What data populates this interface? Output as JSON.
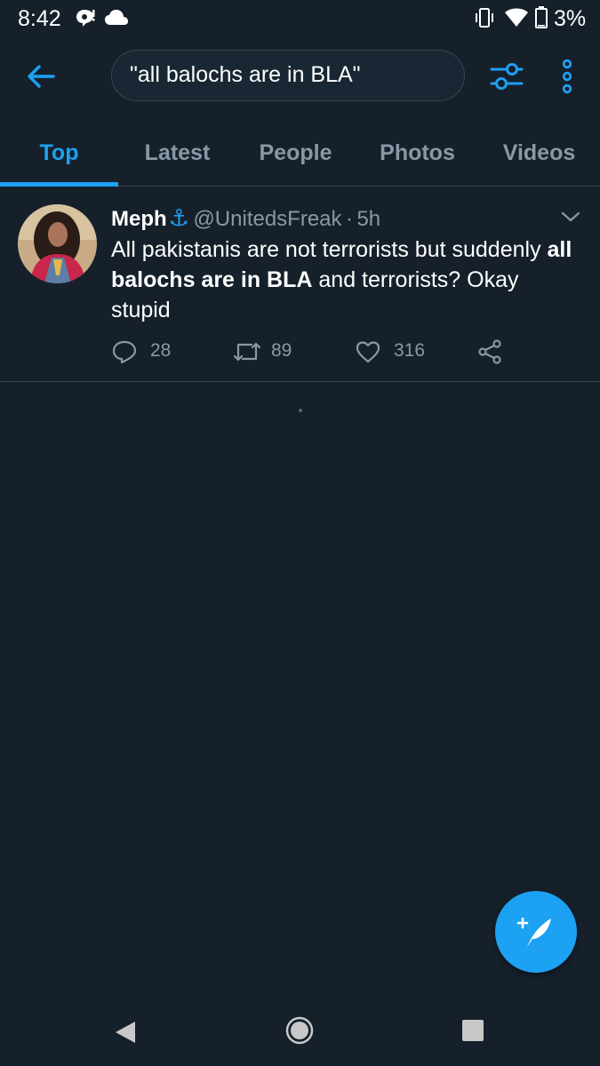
{
  "status_bar": {
    "time": "8:42",
    "battery_percent": "3%",
    "icons": [
      "notification-icon",
      "cloud-icon",
      "vibrate-icon",
      "wifi-icon",
      "battery-icon"
    ]
  },
  "search": {
    "query": "\"all balochs are in BLA\""
  },
  "tabs": [
    {
      "label": "Top",
      "active": true
    },
    {
      "label": "Latest",
      "active": false
    },
    {
      "label": "People",
      "active": false
    },
    {
      "label": "Photos",
      "active": false
    },
    {
      "label": "Videos",
      "active": false
    }
  ],
  "tweet": {
    "name": "Meph",
    "name_emoji": "⚓",
    "handle": "@UnitedsFreak",
    "separator": "·",
    "time": "5h",
    "text_before": "All pakistanis are not terrorists but suddenly ",
    "text_highlight": "all balochs are in BLA",
    "text_after": " and terrorists? Okay stupid",
    "replies": "28",
    "retweets": "89",
    "likes": "316"
  },
  "colors": {
    "background": "#15202b",
    "accent": "#1da1f2",
    "secondary_text": "#8899a6",
    "divider": "#38444d"
  }
}
